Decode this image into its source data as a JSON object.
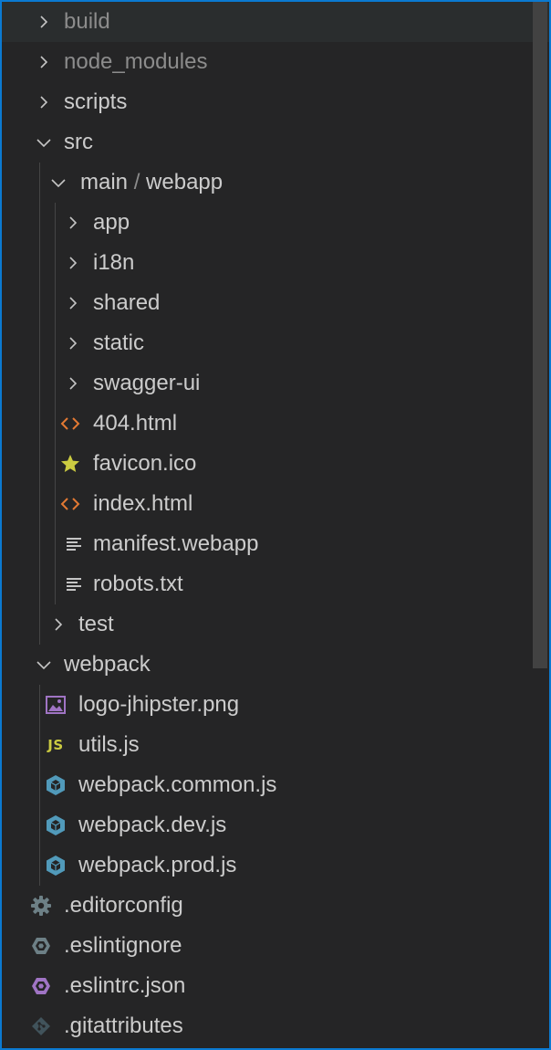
{
  "explorer": {
    "items": [
      {
        "label": "build",
        "kind": "folder",
        "expanded": false,
        "dim": true
      },
      {
        "label": "node_modules",
        "kind": "folder",
        "expanded": false,
        "dim": true
      },
      {
        "label": "scripts",
        "kind": "folder",
        "expanded": false
      },
      {
        "label": "src",
        "kind": "folder",
        "expanded": true
      },
      {
        "label_parts": [
          "main",
          "/",
          "webapp"
        ],
        "kind": "folder",
        "expanded": true
      },
      {
        "label": "app",
        "kind": "folder",
        "expanded": false
      },
      {
        "label": "i18n",
        "kind": "folder",
        "expanded": false
      },
      {
        "label": "shared",
        "kind": "folder",
        "expanded": false
      },
      {
        "label": "static",
        "kind": "folder",
        "expanded": false
      },
      {
        "label": "swagger-ui",
        "kind": "folder",
        "expanded": false
      },
      {
        "label": "404.html",
        "kind": "file",
        "icon": "html-icon"
      },
      {
        "label": "favicon.ico",
        "kind": "file",
        "icon": "star-icon"
      },
      {
        "label": "index.html",
        "kind": "file",
        "icon": "html-icon"
      },
      {
        "label": "manifest.webapp",
        "kind": "file",
        "icon": "text-lines-icon"
      },
      {
        "label": "robots.txt",
        "kind": "file",
        "icon": "text-lines-icon"
      },
      {
        "label": "test",
        "kind": "folder",
        "expanded": false
      },
      {
        "label": "webpack",
        "kind": "folder",
        "expanded": true
      },
      {
        "label": "logo-jhipster.png",
        "kind": "file",
        "icon": "image-icon"
      },
      {
        "label": "utils.js",
        "kind": "file",
        "icon": "js-icon",
        "icon_text": "JS"
      },
      {
        "label": "webpack.common.js",
        "kind": "file",
        "icon": "webpack-cube-icon"
      },
      {
        "label": "webpack.dev.js",
        "kind": "file",
        "icon": "webpack-cube-icon"
      },
      {
        "label": "webpack.prod.js",
        "kind": "file",
        "icon": "webpack-cube-icon"
      },
      {
        "label": ".editorconfig",
        "kind": "file",
        "icon": "gear-icon"
      },
      {
        "label": ".eslintignore",
        "kind": "file",
        "icon": "eslint-hex-icon"
      },
      {
        "label": ".eslintrc.json",
        "kind": "file",
        "icon": "eslint-hex-purple-icon"
      },
      {
        "label": ".gitattributes",
        "kind": "file",
        "icon": "git-icon"
      }
    ]
  },
  "colors": {
    "background": "#252526",
    "text": "#cccccc",
    "text_dim": "#8c8c8c",
    "focus_border": "#0b7ad1",
    "html_icon": "#e37933",
    "star_icon": "#cbcb41",
    "js_icon": "#cbcb41",
    "image_icon": "#a074c4",
    "webpack_icon": "#519aba",
    "eslint_purple": "#a074c4",
    "eslint_gray": "#6d8086",
    "gear_icon": "#6d8086",
    "git_icon": "#41535b"
  }
}
